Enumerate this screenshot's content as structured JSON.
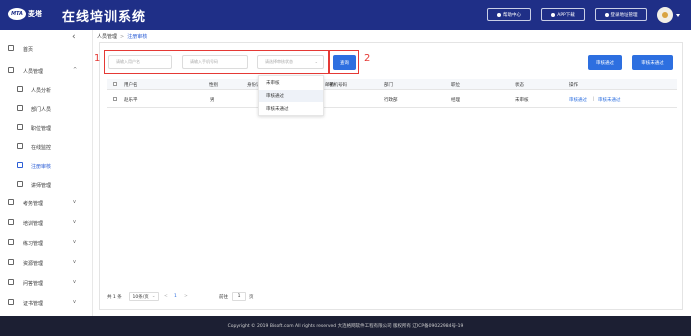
{
  "header": {
    "logo_mark": "MTA",
    "logo_brand": "麦塔",
    "title": "在线培训系统",
    "buttons": [
      "帮助中心",
      "APP下载",
      "登录地址管理"
    ]
  },
  "sidebar": {
    "items": [
      {
        "label": "首页",
        "icon": "home-icon"
      },
      {
        "label": "人员管理",
        "icon": "user-icon",
        "arrow": "^"
      },
      {
        "label": "人员分析",
        "icon": "person-chart-icon"
      },
      {
        "label": "部门人员",
        "icon": "group-icon"
      },
      {
        "label": "职位管理",
        "icon": "position-icon"
      },
      {
        "label": "在线监控",
        "icon": "monitor-icon"
      },
      {
        "label": "注册审核",
        "icon": "review-icon"
      },
      {
        "label": "讲师管理",
        "icon": "teacher-icon"
      },
      {
        "label": "考务管理",
        "icon": "exam-icon",
        "arrow": "v"
      },
      {
        "label": "培训管理",
        "icon": "training-icon",
        "arrow": "v"
      },
      {
        "label": "练习管理",
        "icon": "practice-icon",
        "arrow": "v"
      },
      {
        "label": "资源管理",
        "icon": "resource-icon",
        "arrow": "v"
      },
      {
        "label": "问答管理",
        "icon": "qa-icon",
        "arrow": "v"
      },
      {
        "label": "证书管理",
        "icon": "certificate-icon",
        "arrow": "v"
      }
    ]
  },
  "breadcrumb": {
    "parent": "人员管理",
    "separator": ">",
    "current": "注册审核"
  },
  "filters": {
    "username_placeholder": "请输入用户名",
    "phone_placeholder": "请输入手机号码",
    "status_placeholder": "请选择审核状态",
    "query": "查询",
    "approve": "审核通过",
    "reject": "审核未通过"
  },
  "annotations": {
    "box1": "1",
    "box2": "2"
  },
  "dropdown": {
    "options": [
      "未审核",
      "审核通过",
      "审核未通过"
    ]
  },
  "table": {
    "headers": [
      "用户名",
      "性别",
      "身份证",
      "邮箱",
      "手机号码",
      "部门",
      "职位",
      "状态",
      "操作"
    ],
    "rows": [
      {
        "username": "赵乐平",
        "gender": "男",
        "department": "行政部",
        "position": "经理",
        "status": "未审核",
        "action_approve": "审核通过",
        "action_sep": "|",
        "action_reject": "审核未通过"
      }
    ]
  },
  "pagination": {
    "total": "共 1 条",
    "page_size": "10条/页",
    "prev": "<",
    "current_page": "1",
    "next": ">",
    "goto_label": "前往",
    "goto_value": "1",
    "page_suffix": "页"
  },
  "footer": {
    "copyright": "Copyright © 2019 Bisoft.com All rights reserved 大连格网软件工程有限公司 版权所有 辽ICP备09022984号-19"
  },
  "colors": {
    "header": "#1f2f87",
    "accent": "#2d6fe0",
    "annotation": "#e53935",
    "footer": "#1c1f33"
  }
}
